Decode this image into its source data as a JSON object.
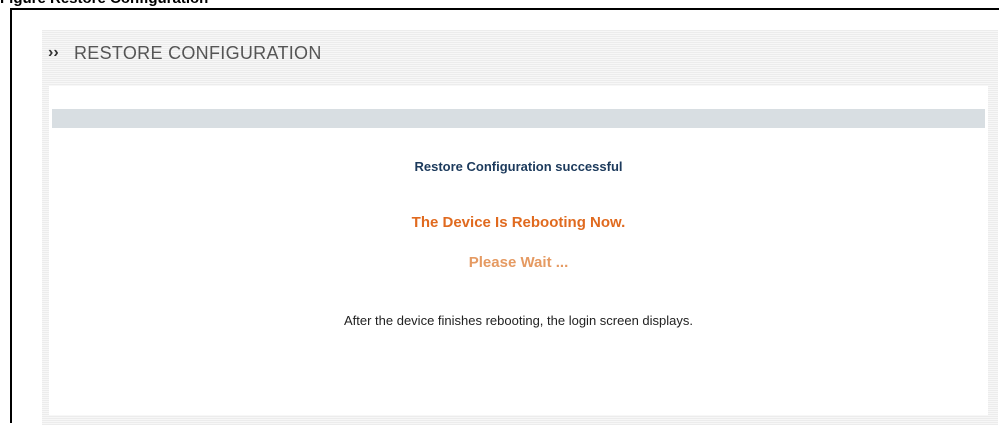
{
  "figure_caption": "Figure    Restore Configuration",
  "window": {
    "title": "RESTORE CONFIGURATION",
    "title_icon": "double-chevron-right-icon"
  },
  "messages": {
    "success": "Restore Configuration successful",
    "rebooting": "The Device Is Rebooting Now.",
    "wait": "Please Wait ...",
    "info": "After the device finishes rebooting, the login screen displays."
  },
  "colors": {
    "success_text": "#1c3a5c",
    "rebooting_text": "#e06a1f",
    "wait_text": "#e59a62",
    "header_strip": "#d8dee2"
  }
}
